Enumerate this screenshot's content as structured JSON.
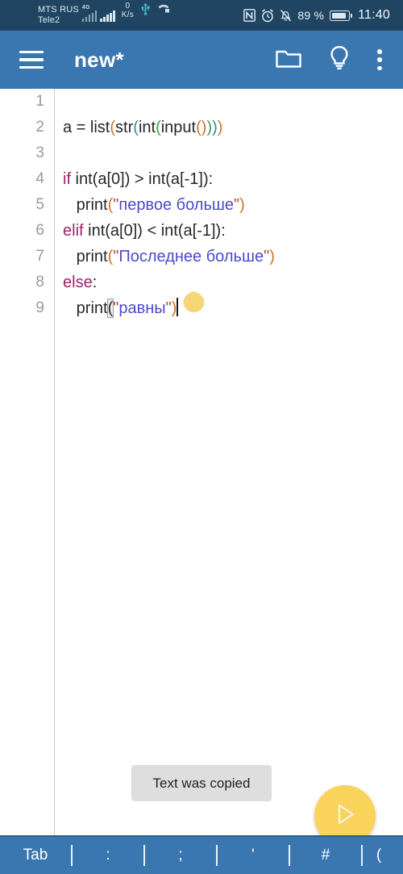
{
  "statusbar": {
    "carrier_line1": "MTS RUS",
    "carrier_line2": "Tele2",
    "network_type": "4G",
    "data_rate_value": "0",
    "data_rate_unit": "K/s",
    "icons": [
      "usb-icon",
      "call-forwarding-icon",
      "nfc-icon",
      "alarm-icon",
      "bell-muted-icon"
    ],
    "battery_percent": "89 %",
    "time": "11:40"
  },
  "appbar": {
    "menu_icon": "hamburger-menu-icon",
    "title": "new*",
    "actions": [
      {
        "icon": "folder-icon",
        "name": "open-folder-button"
      },
      {
        "icon": "lightbulb-icon",
        "name": "hint-button"
      },
      {
        "icon": "kebab-menu-icon",
        "name": "overflow-menu-button"
      }
    ]
  },
  "editor": {
    "line_numbers": [
      "1",
      "2",
      "3",
      "4",
      "5",
      "6",
      "7",
      "8",
      "9"
    ],
    "lines": [
      {
        "n": "1",
        "text": ""
      },
      {
        "n": "2",
        "text": "a = list(str(int(input())))"
      },
      {
        "n": "3",
        "text": ""
      },
      {
        "n": "4",
        "text": "if int(a[0]) > int(a[-1]):"
      },
      {
        "n": "5",
        "text": "   print(\"первое больше\")"
      },
      {
        "n": "6",
        "text": "elif int(a[0]) < int(a[-1]):"
      },
      {
        "n": "7",
        "text": "   print(\"Последнее больше\")"
      },
      {
        "n": "8",
        "text": "else:"
      },
      {
        "n": "9",
        "text": "   print(\"равны\")"
      }
    ],
    "tokens": {
      "l2_a_eq": "a = ",
      "l2_list": "list",
      "l2_str": "str",
      "l2_int": "int",
      "l2_input": "input",
      "kw_if": "if",
      "kw_elif": "elif",
      "kw_else": "else",
      "l4_body": " int(a[0]) > int(a[-1]):",
      "l6_body": " int(a[0]) < int(a[-1]):",
      "l8_colon": ":",
      "print": "print",
      "str_pervoe": "первое больше",
      "str_poslednee": "Последнее больше",
      "str_ravny": "равны",
      "quote": "\"",
      "paren_open": "(",
      "paren_close": ")"
    },
    "cursor_handle": "text-cursor-handle"
  },
  "toast": {
    "message": "Text was copied"
  },
  "fab": {
    "icon": "run-play-icon",
    "label": "Run"
  },
  "keybar": {
    "keys": [
      "Tab",
      ":",
      ";",
      "'",
      "#",
      "("
    ]
  },
  "colors": {
    "statusbar_bg": "#1f4563",
    "appbar_bg": "#3a77b0",
    "editor_bg": "#ffffff",
    "keyword": "#a0206a",
    "string": "#4b4bc8",
    "quote": "#b5472f",
    "bracket_1": "#c8742a",
    "bracket_2": "#2e8f9e",
    "bracket_3": "#3d9d4d",
    "fab_bg": "#fad35a",
    "handle": "#f5d77a",
    "toast_bg": "#dedede"
  }
}
